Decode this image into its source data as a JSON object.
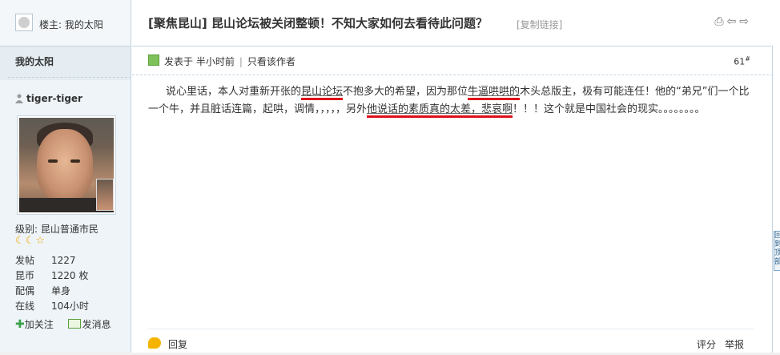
{
  "sidebar": {
    "louzhu_label": "楼主:",
    "louzhu_name": "我的太阳",
    "username_top": "我的太阳",
    "username": "tiger-tiger",
    "level_label": "级别:",
    "level": "昆山普通市民",
    "stars": "☾☾☆",
    "stats": [
      {
        "key": "发帖",
        "value": "1227"
      },
      {
        "key": "昆币",
        "value": "1220 枚"
      },
      {
        "key": "配偶",
        "value": "单身"
      },
      {
        "key": "在线",
        "value": "104小时"
      }
    ],
    "add_friend": "加关注",
    "send_message": "发消息"
  },
  "thread": {
    "category": "[聚焦昆山]",
    "title": "昆山论坛被关闭整顿！不知大家如何去看待此问题？",
    "copy_link": "[复制链接]",
    "icons": [
      "print-icon",
      "prev-thread-icon",
      "next-thread-icon"
    ]
  },
  "post": {
    "posted_at": "发表于 半小时前",
    "only_author": "只看该作者",
    "floor": "61",
    "floor_mark": "#",
    "content_parts": {
      "p1": "说心里话，本人对重新开张的",
      "u1": "昆山论坛",
      "p2": "不抱多大的希望，因为那位",
      "u2": "牛逼哄哄的",
      "p3": "木头总版主，极有可能连任！他的“弟兄”们一个比一个牛，并且脏话连篇，起哄，调情，，，，，另外",
      "u3": "他说话的素质真的太差，悲哀啊",
      "p4": "！！！这个就是中国社会的现实。。。。。。。。"
    },
    "reply": "回复",
    "rate": "评分",
    "report": "举报"
  },
  "side_tab": "回到顶部",
  "colors": {
    "border": "#c2d5e3",
    "sidebar_bg": "#e5edf2",
    "highlight_red": "#e0101a"
  }
}
